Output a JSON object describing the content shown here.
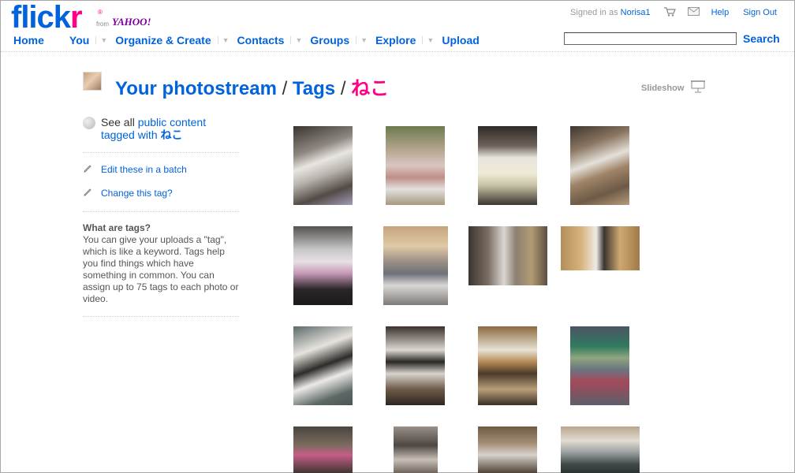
{
  "header": {
    "logo_blue": "flick",
    "logo_pink": "r",
    "logo_reg": "®",
    "from": "from",
    "yahoo": "YAHOO!",
    "signed_in_label": "Signed in as",
    "username": "Norisa1",
    "help": "Help",
    "sign_out": "Sign Out",
    "cart_icon": "cart-icon",
    "mail_icon": "mail-icon"
  },
  "nav": {
    "home": "Home",
    "you": "You",
    "organize": "Organize & Create",
    "contacts": "Contacts",
    "groups": "Groups",
    "explore": "Explore",
    "upload": "Upload"
  },
  "search": {
    "value": "",
    "button": "Search"
  },
  "page": {
    "title_photostream": "Your photostream",
    "title_sep1": "/",
    "title_tags": "Tags",
    "title_sep2": "/",
    "title_tag": "ねこ",
    "slideshow": "Slideshow"
  },
  "sidebar": {
    "see_all_prefix": "See all",
    "public_content": "public content",
    "tagged_with": "tagged with",
    "tag": "ねこ",
    "edit_batch": "Edit these in a batch",
    "change_tag": "Change this tag?",
    "what_heading": "What are tags?",
    "what_body": "You can give your uploads a \"tag\", which is like a keyword. Tags help you find things which have something in common. You can assign up to 75 tags to each photo or video."
  },
  "colors": {
    "link": "#0063dc",
    "brand_pink": "#ff0084"
  },
  "photos": [
    {
      "name": "photo-1"
    },
    {
      "name": "photo-2"
    },
    {
      "name": "photo-3"
    },
    {
      "name": "photo-4"
    },
    {
      "name": "photo-5"
    },
    {
      "name": "photo-6"
    },
    {
      "name": "photo-7"
    },
    {
      "name": "photo-8"
    },
    {
      "name": "photo-9"
    },
    {
      "name": "photo-10"
    },
    {
      "name": "photo-11"
    },
    {
      "name": "photo-12"
    },
    {
      "name": "photo-13"
    },
    {
      "name": "photo-14"
    },
    {
      "name": "photo-15"
    },
    {
      "name": "photo-16"
    }
  ]
}
